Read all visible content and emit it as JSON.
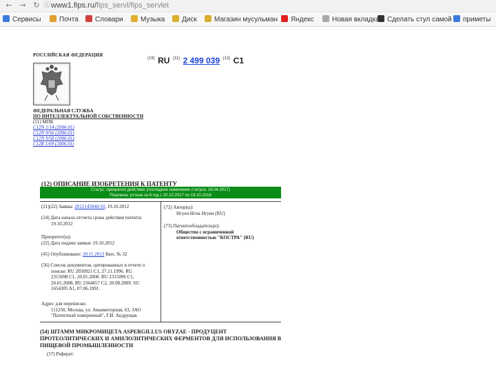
{
  "browser": {
    "back_icon": "arrow-left-icon",
    "forward_icon": "arrow-right-icon",
    "reload_icon": "reload-icon",
    "info_icon": "info-icon",
    "url_main": "www1.fips.ru/",
    "url_rest": "fips_servl/fips_servlet",
    "bookmarks": [
      {
        "label": "Сервисы",
        "color": "#3b7be0"
      },
      {
        "label": "Почта",
        "color": "#e0a030"
      },
      {
        "label": "Словари",
        "color": "#d04040"
      },
      {
        "label": "Музыка",
        "color": "#e0b030"
      },
      {
        "label": "Диск",
        "color": "#d8b030"
      },
      {
        "label": "Магазин мусульман",
        "color": "#d8b030"
      },
      {
        "label": "Яндекс",
        "color": "#e02020"
      },
      {
        "label": "Новая вкладка",
        "color": "#aaaaaa"
      },
      {
        "label": "Сделать стул самой",
        "color": "#333333"
      },
      {
        "label": "приметы",
        "color": "#3b7be0"
      }
    ]
  },
  "patent": {
    "federation": "РОССИЙСКАЯ ФЕДЕРАЦИЯ",
    "service_line1": "ФЕДЕРАЛЬНАЯ СЛУЖБА",
    "service_line2": "ПО ИНТЕЛЛЕКТУАЛЬНОЙ СОБСТВЕННОСТИ",
    "mpk_label": "(51) МПК",
    "mpk": [
      "C12N 1/14 (2006.01)",
      "C12N 9/56 (2006.01)",
      "C12N 9/58 (2006.01)",
      "C12R 1/69 (2006.01)"
    ],
    "code19": "(19)",
    "country": "RU",
    "code11": "(11)",
    "number": "2 499 039",
    "code13": "(13)",
    "kind": "C1",
    "desc_title": "(12) ОПИСАНИЕ ИЗОБРЕТЕНИЯ К ПАТЕНТУ",
    "status_line1": "Статус: прекратил действие (последнее изменение статуса: 18.04.2017)",
    "status_line2": "Пошлина: учтена за 6 год с 20.10.2017 по 19.10.2018",
    "left": {
      "app_label": "(21)(22) Заявка:",
      "app_number": "2012145046/10",
      "app_date": ", 19.10.2012",
      "start_label": "(24) Дата начала отсчета срока действия патента:",
      "start_date": "19.10.2012",
      "priority_label": "Приоритет(ы):",
      "priority_line": "(22) Дата подачи заявки: 19.10.2012",
      "pub_prefix": "(45) Опубликовано:",
      "pub_date": "20.11.2013",
      "pub_suffix": " Бюл. № 32",
      "docs_label": "(56) Список документов, цитированных в отчете о",
      "docs": [
        "поиске: RU 2050921 C1, 27.11.1996. RU",
        "2315098 C1, 20.01.2008. RU 2315096 C1,",
        "20.01.2008. RU 2364657 C2, 20.08.2009. SU",
        "1654305 A1, 07.06.1991."
      ],
      "addr_label": "Адрес для переписки:",
      "addr": [
        "111250, Москва, ул. Авиамоторная, 63, ЗАО",
        "\"Патентный поверенный\", Г.И. Андрущак"
      ]
    },
    "right": {
      "author_label": "(72) Автор(ы):",
      "author": "Нгуен Нгок Нгуен (RU)",
      "owner_label": "(73) Патентообладатель(и):",
      "owner_line1": "Общество с ограниченной",
      "owner_line2": "ответственностью \"КОСТРА\" (RU)"
    },
    "title_line1": "(54) ШТАММ МИКРОМИЦЕТА ASPERGILLUS ORYZAE - ПРОДУЦЕНТ",
    "title_line2": "ПРОТЕОЛИТИЧЕСКИХ И АМИЛОЛИТИЧЕСКИХ ФЕРМЕНТОВ ДЛЯ ИСПОЛЬЗОВАНИЯ В",
    "title_line3": "ПИЩЕВОЙ ПРОМЫШЛЕННОСТИ",
    "abstract_label": "(57) Реферат:"
  }
}
